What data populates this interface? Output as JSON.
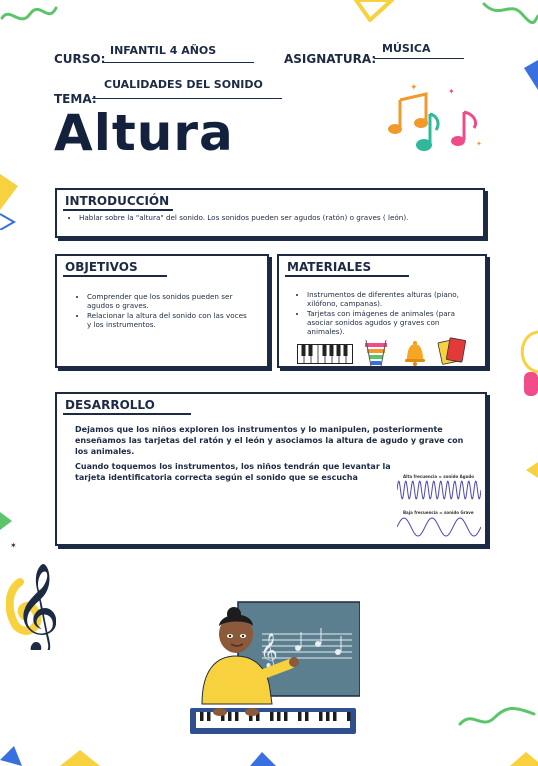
{
  "header": {
    "curso_label": "CURSO:",
    "curso_value": "INFANTIL 4 AÑOS",
    "asignatura_label": "ASIGNATURA:",
    "asignatura_value": "MÚSICA",
    "tema_label": "TEMA:",
    "tema_value": "CUALIDADES DEL SONIDO"
  },
  "title": "Altura",
  "introduccion": {
    "heading": "INTRODUCCIÓN",
    "items": [
      "Hablar sobre la \"altura\" del sonido. Los sonidos pueden ser agudos (ratón) o graves ( león)."
    ]
  },
  "objetivos": {
    "heading": "OBJETIVOS",
    "items": [
      "Comprender que los sonidos pueden ser agudos o graves.",
      "Relacionar la altura del sonido con las voces y los instrumentos."
    ]
  },
  "materiales": {
    "heading": "MATERIALES",
    "items": [
      "Instrumentos de diferentes alturas (piano, xilófono, campanas).",
      "Tarjetas con imágenes de animales (para asociar sonidos agudos y graves con animales)."
    ]
  },
  "desarrollo": {
    "heading": "DESARROLLO",
    "paragraphs": [
      "Dejamos que los niños exploren los instrumentos y lo manipulen, posteriormente enseñamos las tarjetas del ratón y el león y asociamos la altura de agudo y grave con los animales.",
      "Cuando toquemos los instrumentos, los niños tendrán que levantar la tarjeta identificatoria correcta según el sonido que se escucha"
    ],
    "wave_high_label": "Alta frecuencia = sonido Agudo",
    "wave_low_label": "Baja frecuencia = sonido Grave"
  },
  "colors": {
    "navy": "#1c2a44",
    "yellow": "#f7d23e",
    "blue": "#3a6fe0",
    "green": "#5cc46a",
    "pink": "#ee4d8a",
    "orange": "#f19a2b"
  }
}
